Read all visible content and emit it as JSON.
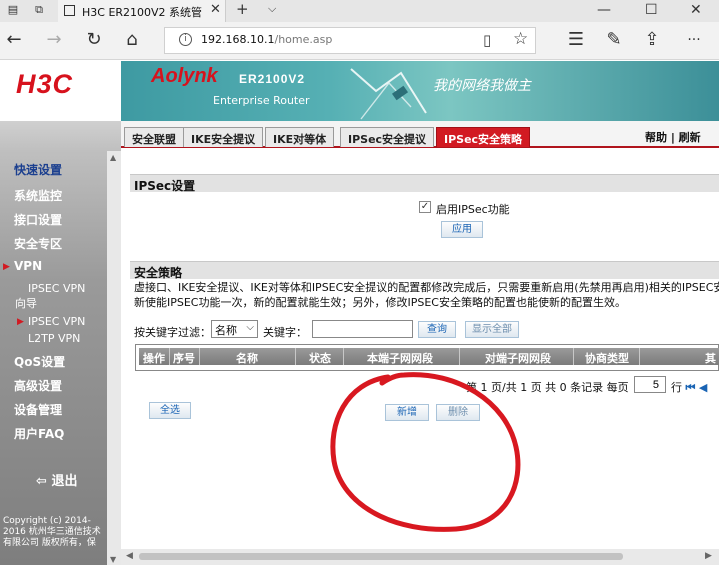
{
  "browser": {
    "tab_title": "H3C ER2100V2 系统管理",
    "close_glyph": "✕",
    "new_tab_glyph": "+",
    "tabs_dropdown_glyph": "⌵",
    "address_host": "192.168.10.1",
    "address_path": "/home.asp",
    "info_glyph": "i",
    "back_glyph": "←",
    "forward_glyph": "→",
    "refresh_glyph": "↻",
    "home_glyph": "⌂",
    "reading_view_glyph": "▯",
    "favorite_glyph": "☆",
    "hub_glyph": "☰",
    "notes_glyph": "✎",
    "share_glyph": "⇪",
    "more_glyph": "···",
    "minimize_glyph": "—",
    "maximize_glyph": "☐",
    "close_window_glyph": "✕"
  },
  "header": {
    "logo": "H3C",
    "brand": "Aolynk",
    "model": "ER2100V2",
    "subtitle": "Enterprise Router",
    "slogan": "我的网络我做主"
  },
  "page_tabs": [
    "安全联盟",
    "IKE安全提议",
    "IKE对等体",
    "IPSec安全提议",
    "IPSec安全策略"
  ],
  "active_tab_index": 4,
  "help_links": "帮助 | 刷新",
  "sidebar": {
    "items": [
      "快速设置",
      "系统监控",
      "接口设置",
      "安全专区",
      "VPN",
      "QoS设置",
      "高级设置",
      "设备管理",
      "用户FAQ"
    ],
    "vpn_sub": [
      "IPSEC VPN向导",
      "IPSEC VPN",
      "L2TP VPN"
    ],
    "arrow_glyph": "▶",
    "logout": "退出",
    "logout_glyph": "⇦",
    "copyright": [
      "Copyright (c) 2014-",
      "2016  杭州华三通信技术",
      "有限公司 版权所有，保"
    ]
  },
  "ipsec_settings": {
    "heading": "IPSec设置",
    "checkbox_label": "启用IPSec功能",
    "checked": true,
    "check_glyph": "✓",
    "apply_button": "应用"
  },
  "policy": {
    "heading": "安全策略",
    "description_line1": "虚接口、IKE安全提议、IKE对等体和IPSEC安全提议的配置都修改完成后，只需要重新启用(先禁用再启用)相关的IPSEC安",
    "description_line2": "新使能IPSEC功能一次，新的配置就能生效；另外，修改IPSEC安全策略的配置也能使新的配置生效。",
    "filter_label": "按关键字过滤：",
    "filter_select": "名称",
    "keyword_label": "关键字：",
    "keyword_value": "",
    "query_button": "查询",
    "show_all_button": "显示全部",
    "columns": [
      "操作",
      "序号",
      "名称",
      "状态",
      "本端子网网段",
      "对端子网网段",
      "协商类型",
      "其"
    ],
    "pager_text": "第 1 页/共 1 页 共 0 条记录 每页",
    "per_page": "5",
    "pager_suffix": "行",
    "first_glyph": "⏮",
    "prev_glyph": "◀",
    "select_all_button": "全选",
    "add_button": "新增",
    "delete_button": "删除"
  },
  "annotation_color": "#d81820"
}
